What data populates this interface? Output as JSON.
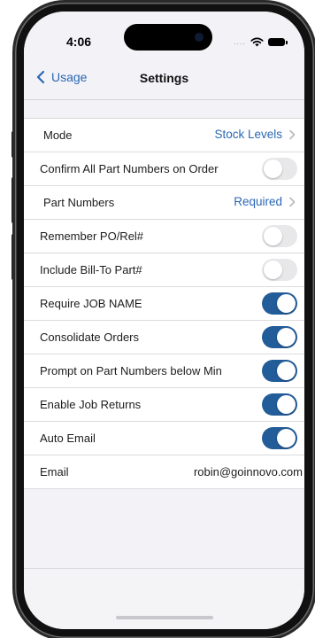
{
  "status_bar": {
    "time": "4:06",
    "signal": "....",
    "wifi_icon": "wifi-icon",
    "battery_icon": "battery-icon"
  },
  "nav": {
    "back_label": "Usage",
    "title": "Settings"
  },
  "settings": {
    "mode": {
      "label": "Mode",
      "value": "Stock Levels"
    },
    "confirm_all": {
      "label": "Confirm All Part Numbers on Order",
      "on": false
    },
    "part_numbers": {
      "label": "Part Numbers",
      "value": "Required"
    },
    "remember_po": {
      "label": "Remember PO/Rel#",
      "on": false
    },
    "include_bill_to": {
      "label": "Include Bill-To Part#",
      "on": false
    },
    "require_job_name": {
      "label": "Require JOB NAME",
      "on": true
    },
    "consolidate_orders": {
      "label": "Consolidate Orders",
      "on": true
    },
    "prompt_below_min": {
      "label": "Prompt on Part Numbers below Min",
      "on": true
    },
    "enable_job_returns": {
      "label": "Enable Job Returns",
      "on": true
    },
    "auto_email": {
      "label": "Auto Email",
      "on": true
    },
    "email": {
      "label": "Email",
      "value": "robin@goinnovo.com"
    }
  },
  "colors": {
    "accent": "#2a67b5",
    "toggle_on": "#225c99",
    "toggle_off": "#e8e8ea",
    "background": "#f2f2f7"
  }
}
